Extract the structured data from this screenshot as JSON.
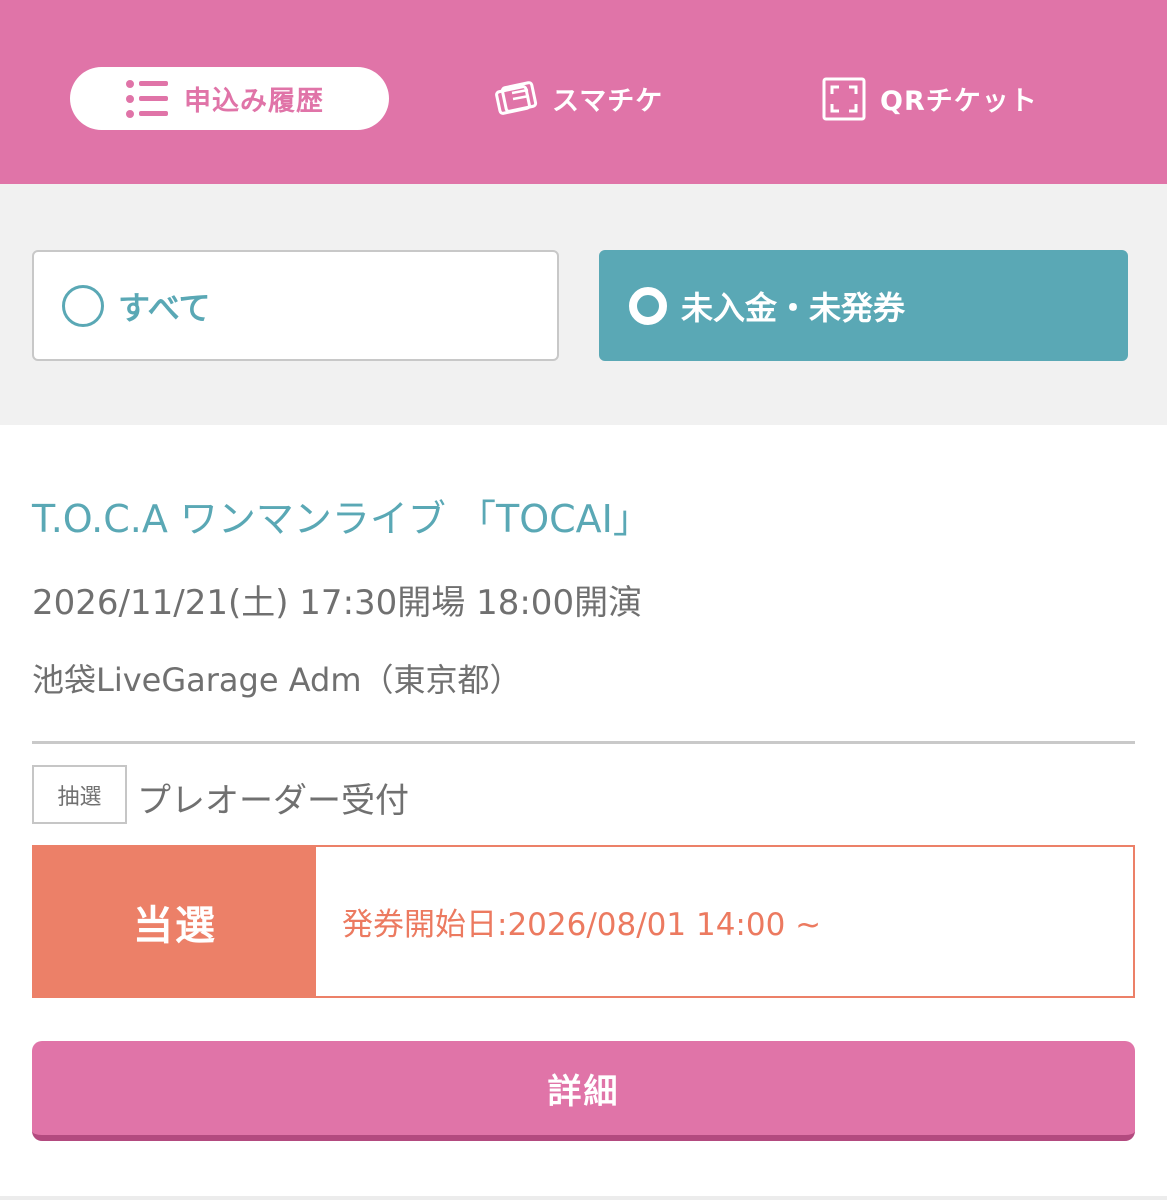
{
  "nav": {
    "tabs": [
      {
        "label": "申込み履歴",
        "icon": "list-icon",
        "active": true
      },
      {
        "label": "スマチケ",
        "icon": "smart-ticket-icon",
        "active": false
      },
      {
        "label": "QRチケット",
        "icon": "qr-frame-icon",
        "active": false
      }
    ]
  },
  "filters": {
    "all_label": "すべて",
    "unpaid_label": "未入金・未発券",
    "selected": "未入金・未発券"
  },
  "event": {
    "title": "T.O.C.A ワンマンライブ 「TOCAI」",
    "datetime": "2026/11/21(土) 17:30開場 18:00開演",
    "venue": "池袋LiveGarage Adm（東京都）"
  },
  "application": {
    "type_badge": "抽選",
    "reception_name": "プレオーダー受付",
    "result_status": "当選",
    "issue_start": "発券開始日:2026/08/01 14:00 ~"
  },
  "actions": {
    "detail_label": "詳細"
  },
  "colors": {
    "brand_pink": "#e074a8",
    "teal": "#5aa8b5",
    "salmon": "#ec8068"
  }
}
